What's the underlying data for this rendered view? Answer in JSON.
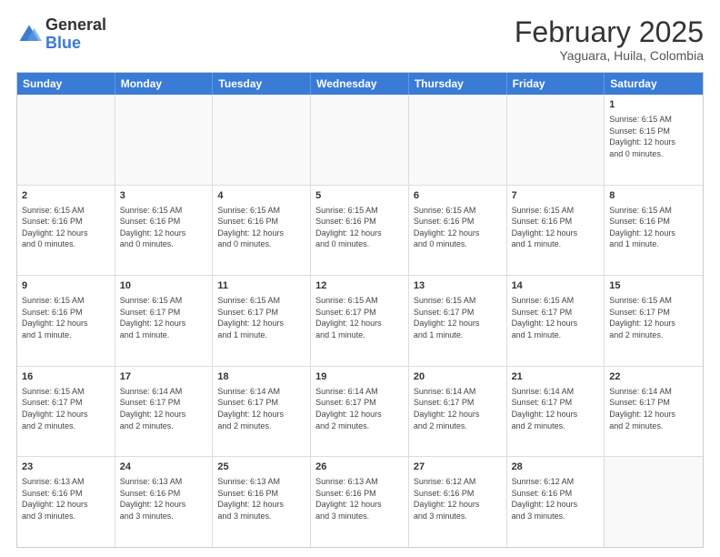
{
  "logo": {
    "general": "General",
    "blue": "Blue"
  },
  "header": {
    "month": "February 2025",
    "location": "Yaguara, Huila, Colombia"
  },
  "weekdays": [
    "Sunday",
    "Monday",
    "Tuesday",
    "Wednesday",
    "Thursday",
    "Friday",
    "Saturday"
  ],
  "rows": [
    [
      {
        "day": "",
        "lines": []
      },
      {
        "day": "",
        "lines": []
      },
      {
        "day": "",
        "lines": []
      },
      {
        "day": "",
        "lines": []
      },
      {
        "day": "",
        "lines": []
      },
      {
        "day": "",
        "lines": []
      },
      {
        "day": "1",
        "lines": [
          "Sunrise: 6:15 AM",
          "Sunset: 6:15 PM",
          "Daylight: 12 hours",
          "and 0 minutes."
        ]
      }
    ],
    [
      {
        "day": "2",
        "lines": [
          "Sunrise: 6:15 AM",
          "Sunset: 6:16 PM",
          "Daylight: 12 hours",
          "and 0 minutes."
        ]
      },
      {
        "day": "3",
        "lines": [
          "Sunrise: 6:15 AM",
          "Sunset: 6:16 PM",
          "Daylight: 12 hours",
          "and 0 minutes."
        ]
      },
      {
        "day": "4",
        "lines": [
          "Sunrise: 6:15 AM",
          "Sunset: 6:16 PM",
          "Daylight: 12 hours",
          "and 0 minutes."
        ]
      },
      {
        "day": "5",
        "lines": [
          "Sunrise: 6:15 AM",
          "Sunset: 6:16 PM",
          "Daylight: 12 hours",
          "and 0 minutes."
        ]
      },
      {
        "day": "6",
        "lines": [
          "Sunrise: 6:15 AM",
          "Sunset: 6:16 PM",
          "Daylight: 12 hours",
          "and 0 minutes."
        ]
      },
      {
        "day": "7",
        "lines": [
          "Sunrise: 6:15 AM",
          "Sunset: 6:16 PM",
          "Daylight: 12 hours",
          "and 1 minute."
        ]
      },
      {
        "day": "8",
        "lines": [
          "Sunrise: 6:15 AM",
          "Sunset: 6:16 PM",
          "Daylight: 12 hours",
          "and 1 minute."
        ]
      }
    ],
    [
      {
        "day": "9",
        "lines": [
          "Sunrise: 6:15 AM",
          "Sunset: 6:16 PM",
          "Daylight: 12 hours",
          "and 1 minute."
        ]
      },
      {
        "day": "10",
        "lines": [
          "Sunrise: 6:15 AM",
          "Sunset: 6:17 PM",
          "Daylight: 12 hours",
          "and 1 minute."
        ]
      },
      {
        "day": "11",
        "lines": [
          "Sunrise: 6:15 AM",
          "Sunset: 6:17 PM",
          "Daylight: 12 hours",
          "and 1 minute."
        ]
      },
      {
        "day": "12",
        "lines": [
          "Sunrise: 6:15 AM",
          "Sunset: 6:17 PM",
          "Daylight: 12 hours",
          "and 1 minute."
        ]
      },
      {
        "day": "13",
        "lines": [
          "Sunrise: 6:15 AM",
          "Sunset: 6:17 PM",
          "Daylight: 12 hours",
          "and 1 minute."
        ]
      },
      {
        "day": "14",
        "lines": [
          "Sunrise: 6:15 AM",
          "Sunset: 6:17 PM",
          "Daylight: 12 hours",
          "and 1 minute."
        ]
      },
      {
        "day": "15",
        "lines": [
          "Sunrise: 6:15 AM",
          "Sunset: 6:17 PM",
          "Daylight: 12 hours",
          "and 2 minutes."
        ]
      }
    ],
    [
      {
        "day": "16",
        "lines": [
          "Sunrise: 6:15 AM",
          "Sunset: 6:17 PM",
          "Daylight: 12 hours",
          "and 2 minutes."
        ]
      },
      {
        "day": "17",
        "lines": [
          "Sunrise: 6:14 AM",
          "Sunset: 6:17 PM",
          "Daylight: 12 hours",
          "and 2 minutes."
        ]
      },
      {
        "day": "18",
        "lines": [
          "Sunrise: 6:14 AM",
          "Sunset: 6:17 PM",
          "Daylight: 12 hours",
          "and 2 minutes."
        ]
      },
      {
        "day": "19",
        "lines": [
          "Sunrise: 6:14 AM",
          "Sunset: 6:17 PM",
          "Daylight: 12 hours",
          "and 2 minutes."
        ]
      },
      {
        "day": "20",
        "lines": [
          "Sunrise: 6:14 AM",
          "Sunset: 6:17 PM",
          "Daylight: 12 hours",
          "and 2 minutes."
        ]
      },
      {
        "day": "21",
        "lines": [
          "Sunrise: 6:14 AM",
          "Sunset: 6:17 PM",
          "Daylight: 12 hours",
          "and 2 minutes."
        ]
      },
      {
        "day": "22",
        "lines": [
          "Sunrise: 6:14 AM",
          "Sunset: 6:17 PM",
          "Daylight: 12 hours",
          "and 2 minutes."
        ]
      }
    ],
    [
      {
        "day": "23",
        "lines": [
          "Sunrise: 6:13 AM",
          "Sunset: 6:16 PM",
          "Daylight: 12 hours",
          "and 3 minutes."
        ]
      },
      {
        "day": "24",
        "lines": [
          "Sunrise: 6:13 AM",
          "Sunset: 6:16 PM",
          "Daylight: 12 hours",
          "and 3 minutes."
        ]
      },
      {
        "day": "25",
        "lines": [
          "Sunrise: 6:13 AM",
          "Sunset: 6:16 PM",
          "Daylight: 12 hours",
          "and 3 minutes."
        ]
      },
      {
        "day": "26",
        "lines": [
          "Sunrise: 6:13 AM",
          "Sunset: 6:16 PM",
          "Daylight: 12 hours",
          "and 3 minutes."
        ]
      },
      {
        "day": "27",
        "lines": [
          "Sunrise: 6:12 AM",
          "Sunset: 6:16 PM",
          "Daylight: 12 hours",
          "and 3 minutes."
        ]
      },
      {
        "day": "28",
        "lines": [
          "Sunrise: 6:12 AM",
          "Sunset: 6:16 PM",
          "Daylight: 12 hours",
          "and 3 minutes."
        ]
      },
      {
        "day": "",
        "lines": []
      }
    ]
  ]
}
